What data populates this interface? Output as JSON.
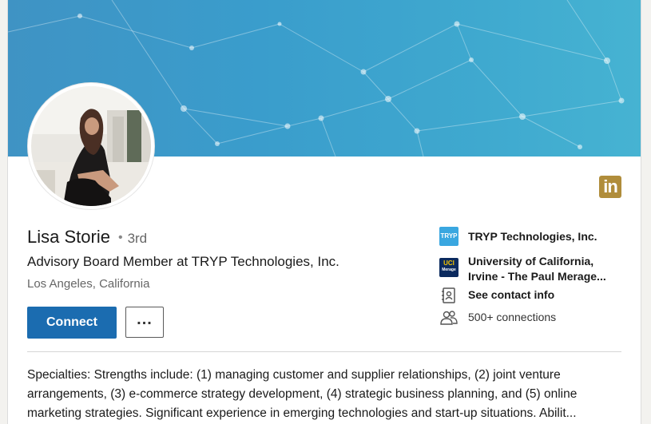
{
  "profile": {
    "name": "Lisa Storie",
    "degree_separator": "•",
    "degree": "3rd",
    "headline": "Advisory Board Member at TRYP Technologies, Inc.",
    "location": "Los Angeles, California"
  },
  "actions": {
    "connect_label": "Connect",
    "more_label": "..."
  },
  "brand": {
    "logo_text": "in",
    "color": "#b08d3b"
  },
  "sidebar": {
    "company": {
      "logo_text": "TRYP",
      "label": "TRYP Technologies, Inc."
    },
    "education": {
      "logo_text": "UCI",
      "logo_subtext": "Merage",
      "label_line1": "University of California,",
      "label_line2": "Irvine - The Paul Merage..."
    },
    "contact": {
      "icon": "contact-card-icon",
      "label": "See contact info"
    },
    "connections": {
      "icon": "people-icon",
      "label": "500+ connections"
    }
  },
  "summary": {
    "line1": "Specialties: Strengths include: (1) managing customer and supplier relationships, (2) joint venture",
    "line2": "arrangements, (3) e-commerce strategy development, (4) strategic business planning, and (5) online",
    "line3": "marketing strategies. Significant experience in emerging technologies and start-up situations. Abilit..."
  },
  "colors": {
    "accent": "#1b6cb0",
    "banner": "#3a9dcc"
  }
}
